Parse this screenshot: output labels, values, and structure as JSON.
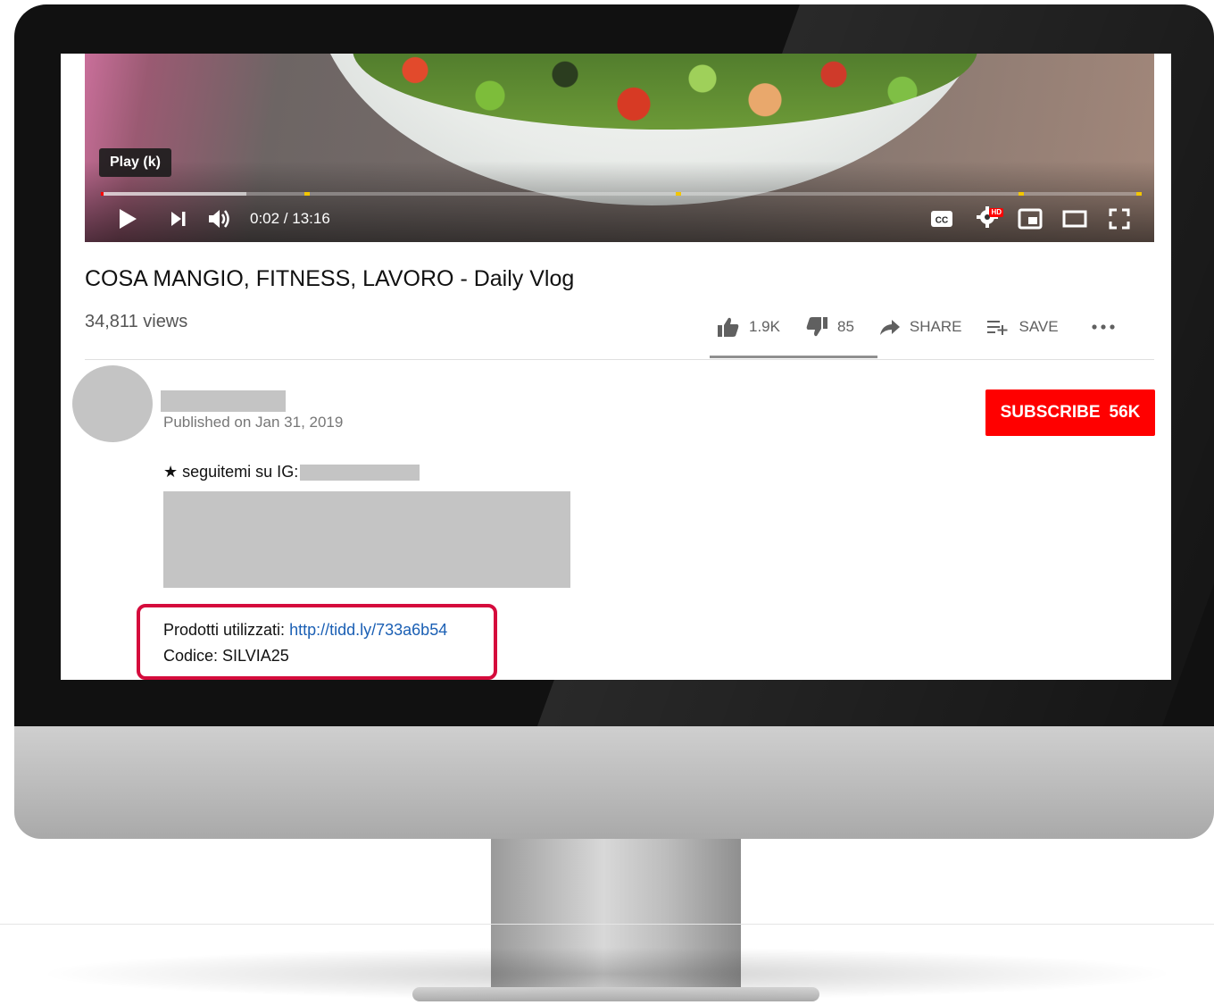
{
  "video": {
    "tooltip": "Play (k)",
    "time_display": "0:02 / 13:16",
    "progress_played_fraction": 0.0025,
    "progress_buffered_fraction": 0.14,
    "icons": [
      "play-icon",
      "next-icon",
      "volume-icon",
      "captions-icon",
      "settings-icon",
      "miniplayer-icon",
      "theater-mode-icon",
      "fullscreen-icon"
    ],
    "hd_badge": "HD"
  },
  "meta": {
    "title": "COSA MANGIO, FITNESS, LAVORO - Daily Vlog",
    "views": "34,811 views",
    "likes": "1.9K",
    "dislikes": "85",
    "share_label": "SHARE",
    "save_label": "SAVE"
  },
  "channel": {
    "published": "Published on Jan 31, 2019",
    "subscribe_label": "SUBSCRIBE",
    "subscriber_count": "56K"
  },
  "description": {
    "ig_line": "★ seguitemi su IG:",
    "products_label": "Prodotti utilizzati:",
    "products_link": "http://tidd.ly/733a6b54",
    "code_line": "Codice: SILVIA25"
  },
  "colors": {
    "subscribe": "#ff0000",
    "link": "#1a5fb4",
    "highlight": "#d50b3c",
    "progress_marker": "#f3c600"
  }
}
